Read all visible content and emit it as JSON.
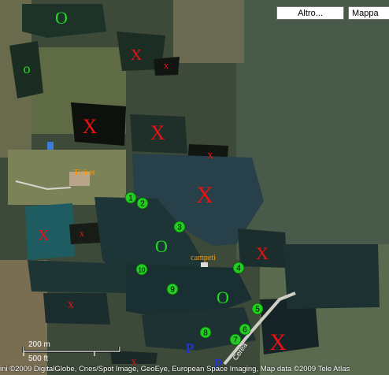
{
  "controls": {
    "more_label": "Altro...",
    "map_label": "Mappa"
  },
  "scale": {
    "metric": "200 m",
    "imperial": "500 ft"
  },
  "copyright": "ini ©2009 DigitalGlobe, Cnes/Spot Image, GeoEye, European Space Imaging, Map data ©2009 Tele Atlas",
  "markers": {
    "big_o": "O",
    "small_o": "o",
    "big_x": "X",
    "small_x": "x",
    "parking": "P",
    "ticket": "Ticket",
    "campsite": "campeti",
    "road": "Cerea"
  },
  "numbered_markers": [
    "1",
    "2",
    "3",
    "4",
    "5",
    "6",
    "7",
    "8",
    "9",
    "10"
  ],
  "colors": {
    "o_marker": "#22dd22",
    "x_marker": "#ee1111",
    "parking": "#2233dd",
    "label": "#ff9900",
    "number_circle": "#22cc22"
  }
}
